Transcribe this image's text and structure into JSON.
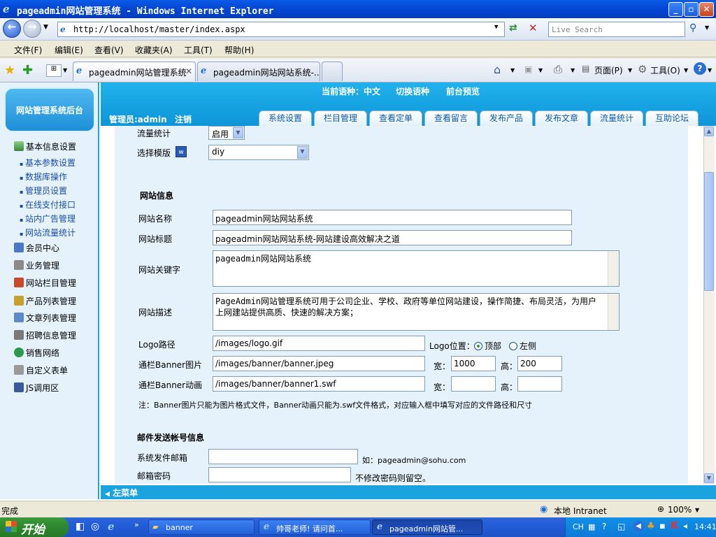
{
  "window": {
    "title": "pageadmin网站管理系统 - Windows Internet Explorer"
  },
  "address": {
    "url": "http://localhost/master/index.aspx",
    "search_placeholder": "Live Search"
  },
  "menu": [
    "文件(F)",
    "编辑(E)",
    "查看(V)",
    "收藏夹(A)",
    "工具(T)",
    "帮助(H)"
  ],
  "tabs": [
    "pageadmin网站管理系统",
    "pageadmin网站网站系统-..."
  ],
  "commandbar": {
    "page": "页面(P)",
    "tools": "工具(O)"
  },
  "sidebar": {
    "logo": "网站管理系统后台",
    "section1": "基本信息设置",
    "subs": [
      "基本参数设置",
      "数据库操作",
      "管理员设置",
      "在线支付接口",
      "站内广告管理",
      "网站流量统计"
    ],
    "items": [
      "会员中心",
      "业务管理",
      "网站栏目管理",
      "产品列表管理",
      "文章列表管理",
      "招聘信息管理",
      "销售网络",
      "自定义表单",
      "JS调用区"
    ]
  },
  "header": {
    "language": "当前语种：中文",
    "switch": "切换语种",
    "preview": "前台预览",
    "admin": "管理员:admin",
    "logout": "注销"
  },
  "nav_tabs": [
    "系统设置",
    "栏目管理",
    "查看定单",
    "查看留言",
    "发布产品",
    "发布文章",
    "流量统计",
    "互助论坛"
  ],
  "form": {
    "stats_label": "流量统计",
    "stats_value": "启用",
    "template_label": "选择模版",
    "template_value": "diy",
    "section_site": "网站信息",
    "name_label": "网站名称",
    "name_value": "pageadmin网站网站系统",
    "title_label": "网站标题",
    "title_value": "pageadmin网站网站系统-网站建设高效解决之道",
    "keywords_label": "网站关键字",
    "keywords_value": "pageadmin网站网站系统",
    "desc_label": "网站描述",
    "desc_value": "PageAdmin网站管理系统可用于公司企业、学校、政府等单位网站建设，操作简捷、布局灵活，为用户上网建站提供高质、快速的解决方案；",
    "logo_label": "Logo路径",
    "logo_value": "/images/logo.gif",
    "logo_pos_label": "Logo位置：",
    "logo_pos_top": "顶部",
    "logo_pos_left": "左侧",
    "banner_label": "通栏Banner图片",
    "banner_value": "/images/banner/banner.jpeg",
    "width_label": "宽：",
    "width_value": "1000",
    "height_label": "高：",
    "height_value": "200",
    "banner_anim_label": "通栏Banner动画",
    "banner_anim_value": "/images/banner/banner1.swf",
    "width2_value": "",
    "height2_value": "",
    "note": "注：Banner图片只能为图片格式文件，Banner动画只能为.swf文件格式，对应输入框中填写对应的文件路径和尺寸",
    "section_mail": "邮件发送帐号信息",
    "mail_label": "系统发件邮箱",
    "mail_value": "",
    "mail_hint": "如：pageadmin@sohu.com",
    "pwd_label": "邮箱密码",
    "pwd_value": "",
    "pwd_hint": "不修改密码则留空。"
  },
  "bottom_band": "左菜单",
  "status": {
    "left": "完成",
    "zone": "本地 Intranet",
    "zoom": "100%"
  },
  "taskbar": {
    "start": "开始",
    "tasks": [
      "banner",
      "帅哥老师! 请问首...",
      "pageadmin网站管..."
    ],
    "lang": "CH",
    "time": "14:41"
  }
}
